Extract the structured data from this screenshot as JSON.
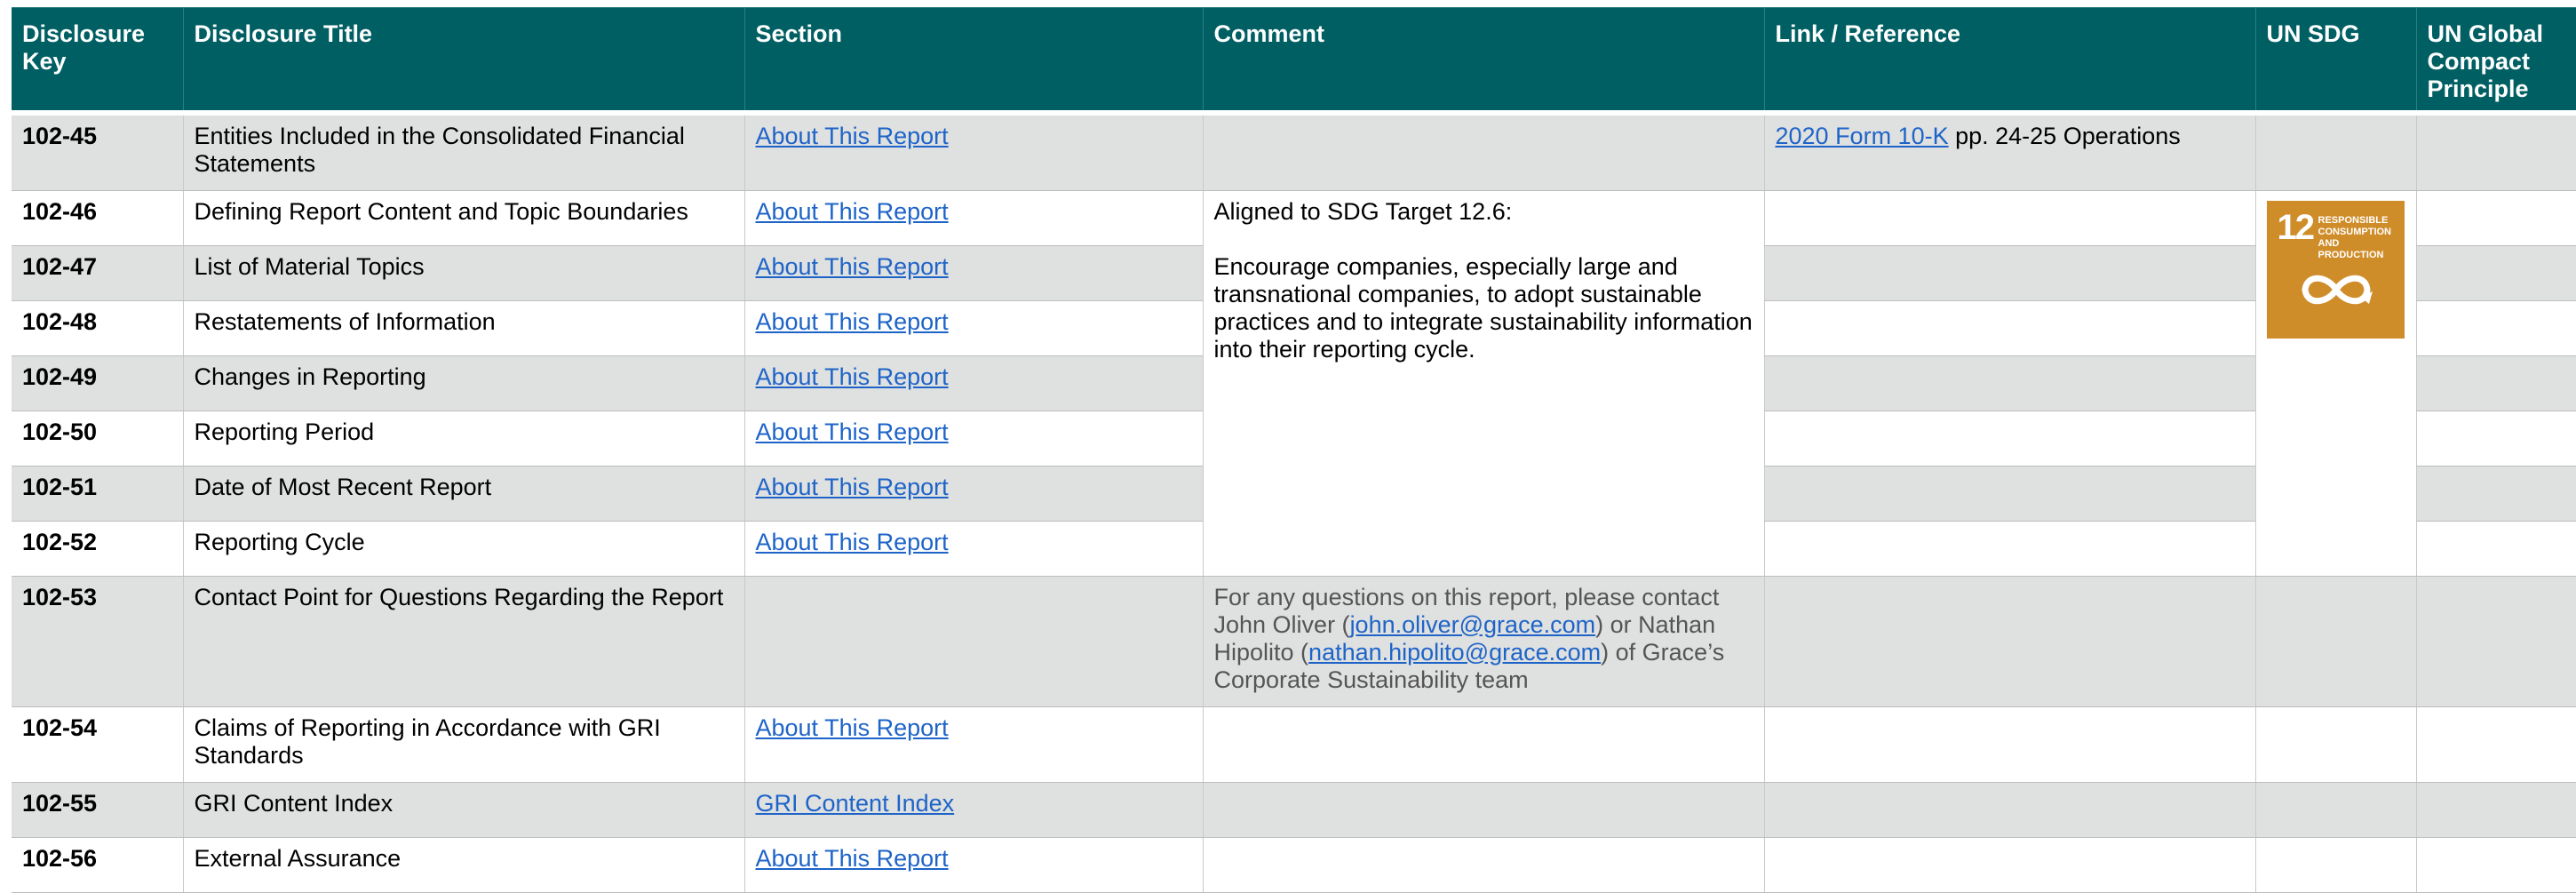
{
  "headers": {
    "key": "Disclosure Key",
    "title": "Disclosure Title",
    "section": "Section",
    "comment": "Comment",
    "link": "Link / Reference",
    "sdg": "UN SDG",
    "ungc": "UN Global Compact Principle"
  },
  "rows": [
    {
      "key": "102-45",
      "title": "Entities Included in the Consolidated Financial Statements",
      "section": "About This Report",
      "link_text": "2020 Form 10-K",
      "link_suffix": " pp. 24-25 Operations"
    },
    {
      "key": "102-46",
      "title": "Defining Report Content and Topic Boundaries",
      "section": "About This Report"
    },
    {
      "key": "102-47",
      "title": "List of Material Topics",
      "section": "About This Report"
    },
    {
      "key": "102-48",
      "title": "Restatements of Information",
      "section": "About This Report"
    },
    {
      "key": "102-49",
      "title": "Changes in Reporting",
      "section": "About This Report"
    },
    {
      "key": "102-50",
      "title": "Reporting Period",
      "section": "About This Report"
    },
    {
      "key": "102-51",
      "title": "Date of Most Recent Report",
      "section": "About This Report"
    },
    {
      "key": "102-52",
      "title": "Reporting Cycle",
      "section": "About This Report"
    },
    {
      "key": "102-53",
      "title": "Contact Point for Questions Regarding the Report",
      "section": ""
    },
    {
      "key": "102-54",
      "title": "Claims of Reporting in Accordance with GRI Standards",
      "section": "About This Report"
    },
    {
      "key": "102-55",
      "title": "GRI Content Index",
      "section": "GRI Content Index"
    },
    {
      "key": "102-56",
      "title": "External Assurance",
      "section": "About This Report"
    }
  ],
  "sdg_comment": {
    "line1": "Aligned to SDG Target 12.6:",
    "line2": "Encourage companies, especially large and transnational companies, to adopt sustainable practices and to integrate sustainability information into their reporting cycle."
  },
  "contact_comment": {
    "part1": "For any questions on this report, please contact John Oliver (",
    "email1": "john.oliver@grace.com",
    "part2": ") or Nathan Hipolito (",
    "email2": "nathan.hipolito@grace.com",
    "part3": ") of Grace’s Corporate Sustainability team"
  },
  "sdg_tile": {
    "number": "12",
    "label": "RESPONSIBLE CONSUMPTION AND PRODUCTION",
    "color": "#cf8d2a",
    "icon": "infinity-loop-icon"
  },
  "colors": {
    "header_bg": "#005f63",
    "shaded_row": "#dfe0e0",
    "link": "#1e64c8"
  }
}
